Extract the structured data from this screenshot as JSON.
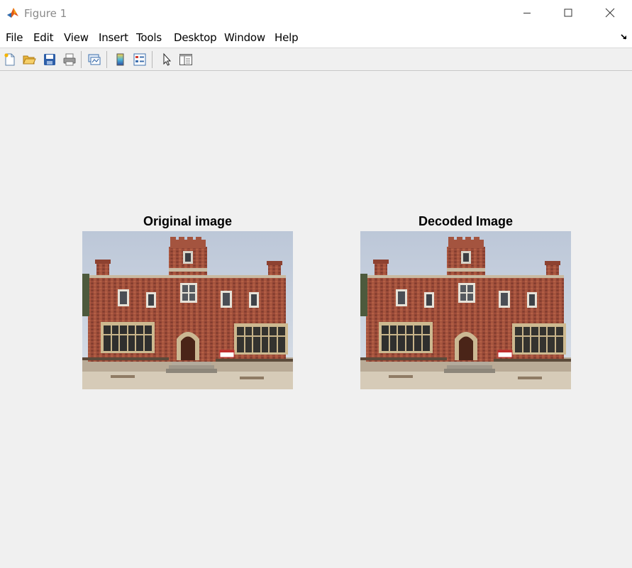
{
  "window": {
    "title": "Figure 1"
  },
  "menubar": {
    "items": [
      "File",
      "Edit",
      "View",
      "Insert",
      "Tools",
      "Desktop",
      "Window",
      "Help"
    ]
  },
  "toolbar": {
    "buttons": [
      {
        "name": "new-figure",
        "icon": "new-file-icon"
      },
      {
        "name": "open-file",
        "icon": "folder-open-icon"
      },
      {
        "name": "save-figure",
        "icon": "save-disk-icon"
      },
      {
        "name": "print-figure",
        "icon": "printer-icon"
      },
      {
        "name": "link-plot",
        "icon": "link-plot-icon"
      },
      {
        "name": "insert-colorbar",
        "icon": "colorbar-icon"
      },
      {
        "name": "insert-legend",
        "icon": "legend-icon"
      },
      {
        "name": "edit-plot",
        "icon": "pointer-arrow-icon"
      },
      {
        "name": "property-inspector",
        "icon": "panel-toggle-icon"
      }
    ]
  },
  "axes": [
    {
      "title": "Original image",
      "image": "building-photo"
    },
    {
      "title": "Decoded Image",
      "image": "building-photo"
    }
  ],
  "colors": {
    "window_bg": "#f0f0f0",
    "titlebar_bg": "#ffffff",
    "brick": "#9e4a37",
    "sky": "#c9d3e0"
  }
}
